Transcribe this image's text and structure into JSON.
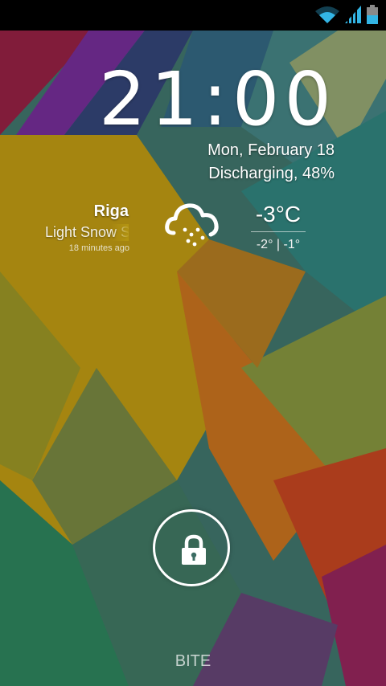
{
  "status_bar": {
    "icons": [
      "wifi-icon",
      "cell-signal-icon",
      "battery-icon"
    ],
    "accent": "#33b5e5"
  },
  "lockscreen": {
    "clock": {
      "hours": "21",
      "separator": ":",
      "minutes": "00"
    },
    "date": "Mon, February 18",
    "battery_status": "Discharging, 48%",
    "weather": {
      "city": "Riga",
      "condition": "Light Snow S",
      "updated": "18 minutes ago",
      "icon": "snow-cloud-icon",
      "temperature": "-3°C",
      "range": "-2° | -1°"
    },
    "unlock_icon": "lock-icon",
    "carrier": "BITE"
  }
}
